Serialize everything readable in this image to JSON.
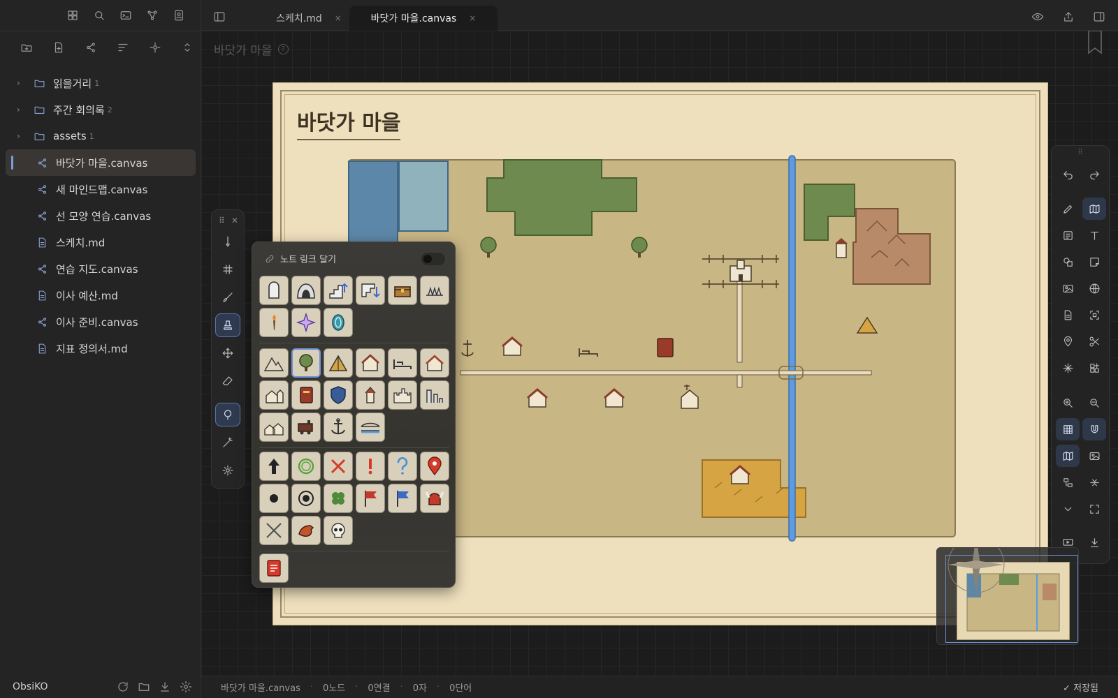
{
  "app": {
    "vault_name": "ObsiKO"
  },
  "sidebar": {
    "tree": [
      {
        "type": "folder",
        "label": "읽을거리",
        "count": "1"
      },
      {
        "type": "folder",
        "label": "주간 회의록",
        "count": "2"
      },
      {
        "type": "folder",
        "label": "assets",
        "count": "1"
      },
      {
        "type": "canvas",
        "label": "바닷가 마을.canvas",
        "active": true
      },
      {
        "type": "canvas",
        "label": "새 마인드맵.canvas"
      },
      {
        "type": "canvas",
        "label": "선 모양 연습.canvas"
      },
      {
        "type": "md",
        "label": "스케치.md"
      },
      {
        "type": "canvas",
        "label": "연습 지도.canvas"
      },
      {
        "type": "md",
        "label": "이사 예산.md"
      },
      {
        "type": "canvas",
        "label": "이사 준비.canvas"
      },
      {
        "type": "md",
        "label": "지표 정의서.md"
      }
    ]
  },
  "tabs": [
    {
      "label": "스케치.md",
      "close": "×",
      "active": false
    },
    {
      "label": "바닷가 마을.canvas",
      "close": "×",
      "active": true
    }
  ],
  "canvas": {
    "view_title": "바닷가 마을",
    "help": "?",
    "map_title": "바닷가 마을"
  },
  "palette": {
    "link_toggle_label": "노트 링크 달기",
    "link_toggle_on": false
  },
  "statusbar": {
    "file": "바닷가 마을.canvas",
    "nodes": "0노드",
    "links": "0연결",
    "chars": "0자",
    "words": "0단어",
    "saved": "✓ 저장됨"
  },
  "colors": {
    "accent": "#7d9ce0",
    "parchment": "#efe0bd",
    "grass": "#c9b685",
    "forest": "#6e8a4e",
    "water": "#5d87a8",
    "river": "#5e9be0",
    "mountain": "#b98a68",
    "wheat": "#d6a443"
  }
}
